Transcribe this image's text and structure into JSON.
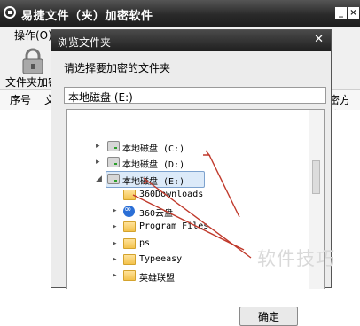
{
  "app": {
    "title": "易捷文件（夹）加密软件",
    "menu": "操作(O)",
    "toolbar_label": "文件夹加密",
    "columns": [
      "序号",
      "文",
      "密方式"
    ]
  },
  "dialog": {
    "title": "浏览文件夹",
    "prompt": "请选择要加密的文件夹",
    "path": "本地磁盘 (E:)",
    "ok_button": "确定",
    "tree": [
      {
        "label": "本地磁盘 (C:)",
        "type": "drive",
        "arrow": "▸"
      },
      {
        "label": "本地磁盘 (D:)",
        "type": "drive",
        "arrow": "▸"
      },
      {
        "label": "本地磁盘 (E:)",
        "type": "drive",
        "arrow": "◢",
        "selected": true
      },
      {
        "label": "360Downloads",
        "type": "folder",
        "arrow": ""
      },
      {
        "label": "360云盘",
        "type": "cloud",
        "arrow": "▸"
      },
      {
        "label": "Program Files",
        "type": "folder",
        "arrow": "▸"
      },
      {
        "label": "ps",
        "type": "folder",
        "arrow": "▸"
      },
      {
        "label": "Typeeasy",
        "type": "folder",
        "arrow": "▸"
      },
      {
        "label": "英雄联盟",
        "type": "folder",
        "arrow": "▸"
      }
    ]
  },
  "watermark": "软件技巧",
  "colors": {
    "annotation_arrow": "#c0392b",
    "selection": "#dceaf9"
  }
}
